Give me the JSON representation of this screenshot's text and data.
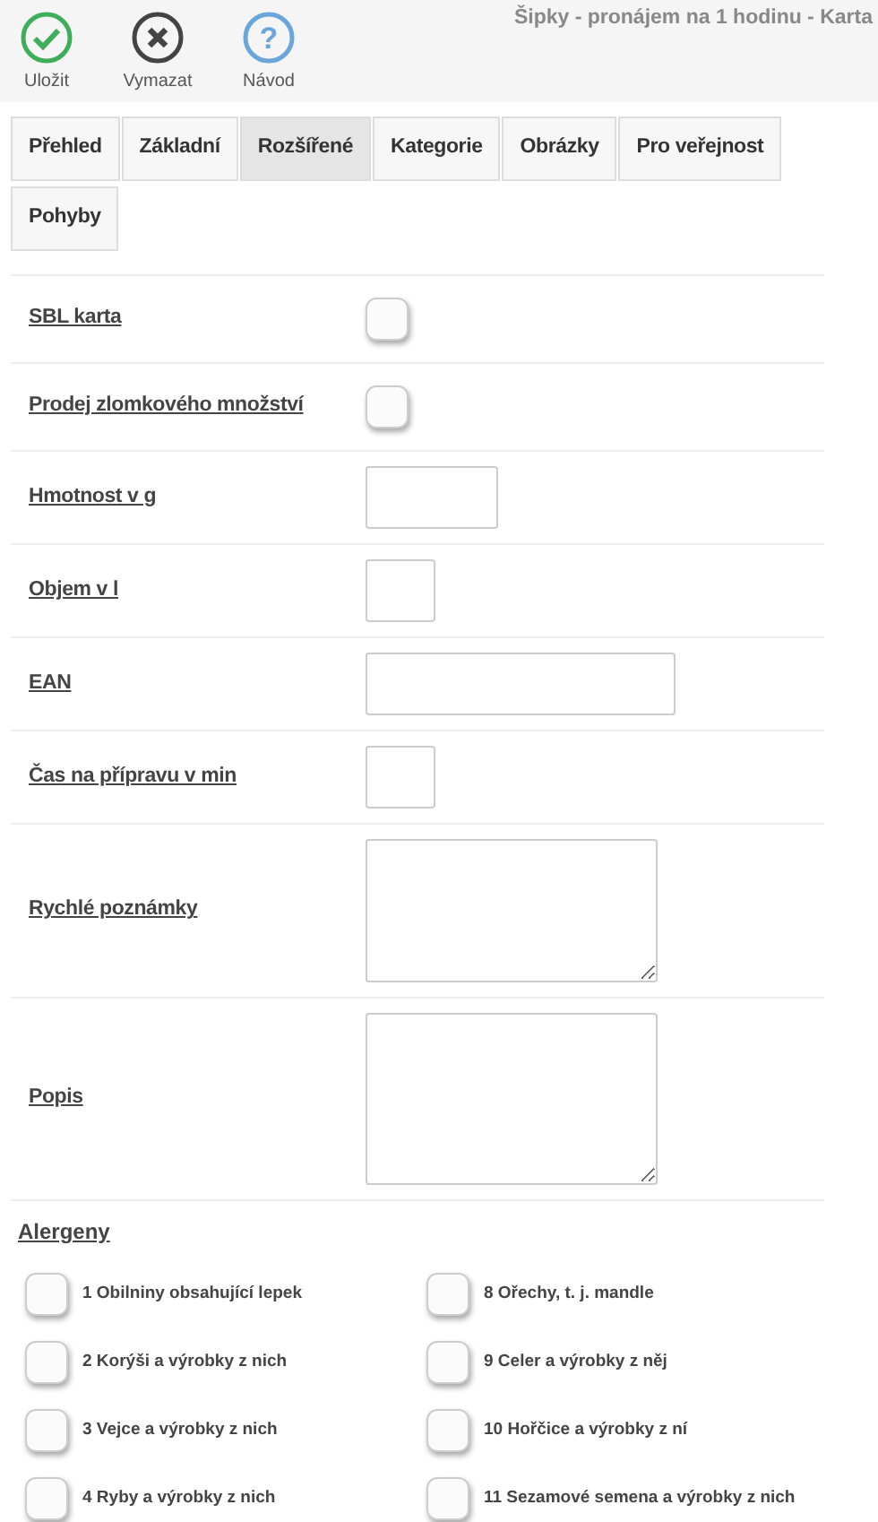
{
  "toolbar": {
    "buttons": [
      {
        "kind": "save",
        "label": "Uložit"
      },
      {
        "kind": "delete",
        "label": "Vymazat"
      },
      {
        "kind": "help",
        "label": "Návod",
        "glyph": "?"
      }
    ],
    "title": "Šipky - pronájem na 1 hodinu - Karta"
  },
  "tabs": [
    {
      "label": "Přehled",
      "selected": false
    },
    {
      "label": "Základní",
      "selected": false
    },
    {
      "label": "Rozšířené",
      "selected": true
    },
    {
      "label": "Kategorie",
      "selected": false
    },
    {
      "label": "Obrázky",
      "selected": false
    },
    {
      "label": "Pro veřejnost",
      "selected": false
    },
    {
      "label": "Pohyby",
      "selected": false
    }
  ],
  "fields": [
    {
      "label": "SBL karta",
      "kind": "checkbox",
      "checked": false
    },
    {
      "label": "Prodej zlomkového množství",
      "kind": "checkbox",
      "checked": false
    },
    {
      "label": "Hmotnost v g",
      "kind": "input"
    },
    {
      "label": "Objem v l",
      "kind": "input"
    },
    {
      "label": "EAN",
      "kind": "input"
    },
    {
      "label": "Čas na přípravu v min",
      "kind": "input"
    },
    {
      "label": "Rychlé poznámky",
      "kind": "textarea"
    },
    {
      "label": "Popis",
      "kind": "textarea"
    }
  ],
  "allergens": {
    "label": "Alergeny",
    "left": [
      {
        "label": "1 Obilniny obsahující lepek",
        "checked": false
      },
      {
        "label": "2 Korýši a výrobky z nich",
        "checked": false
      },
      {
        "label": "3 Vejce a výrobky z nich",
        "checked": false
      },
      {
        "label": "4 Ryby a výrobky z nich",
        "checked": false
      }
    ],
    "right": [
      {
        "label": "8 Ořechy, t. j. mandle",
        "checked": false
      },
      {
        "label": "9 Celer a výrobky z něj",
        "checked": false
      },
      {
        "label": "10 Hořčice a výrobky z ní",
        "checked": false
      },
      {
        "label": "11 Sezamové semena a výrobky z nich",
        "checked": false
      }
    ]
  }
}
